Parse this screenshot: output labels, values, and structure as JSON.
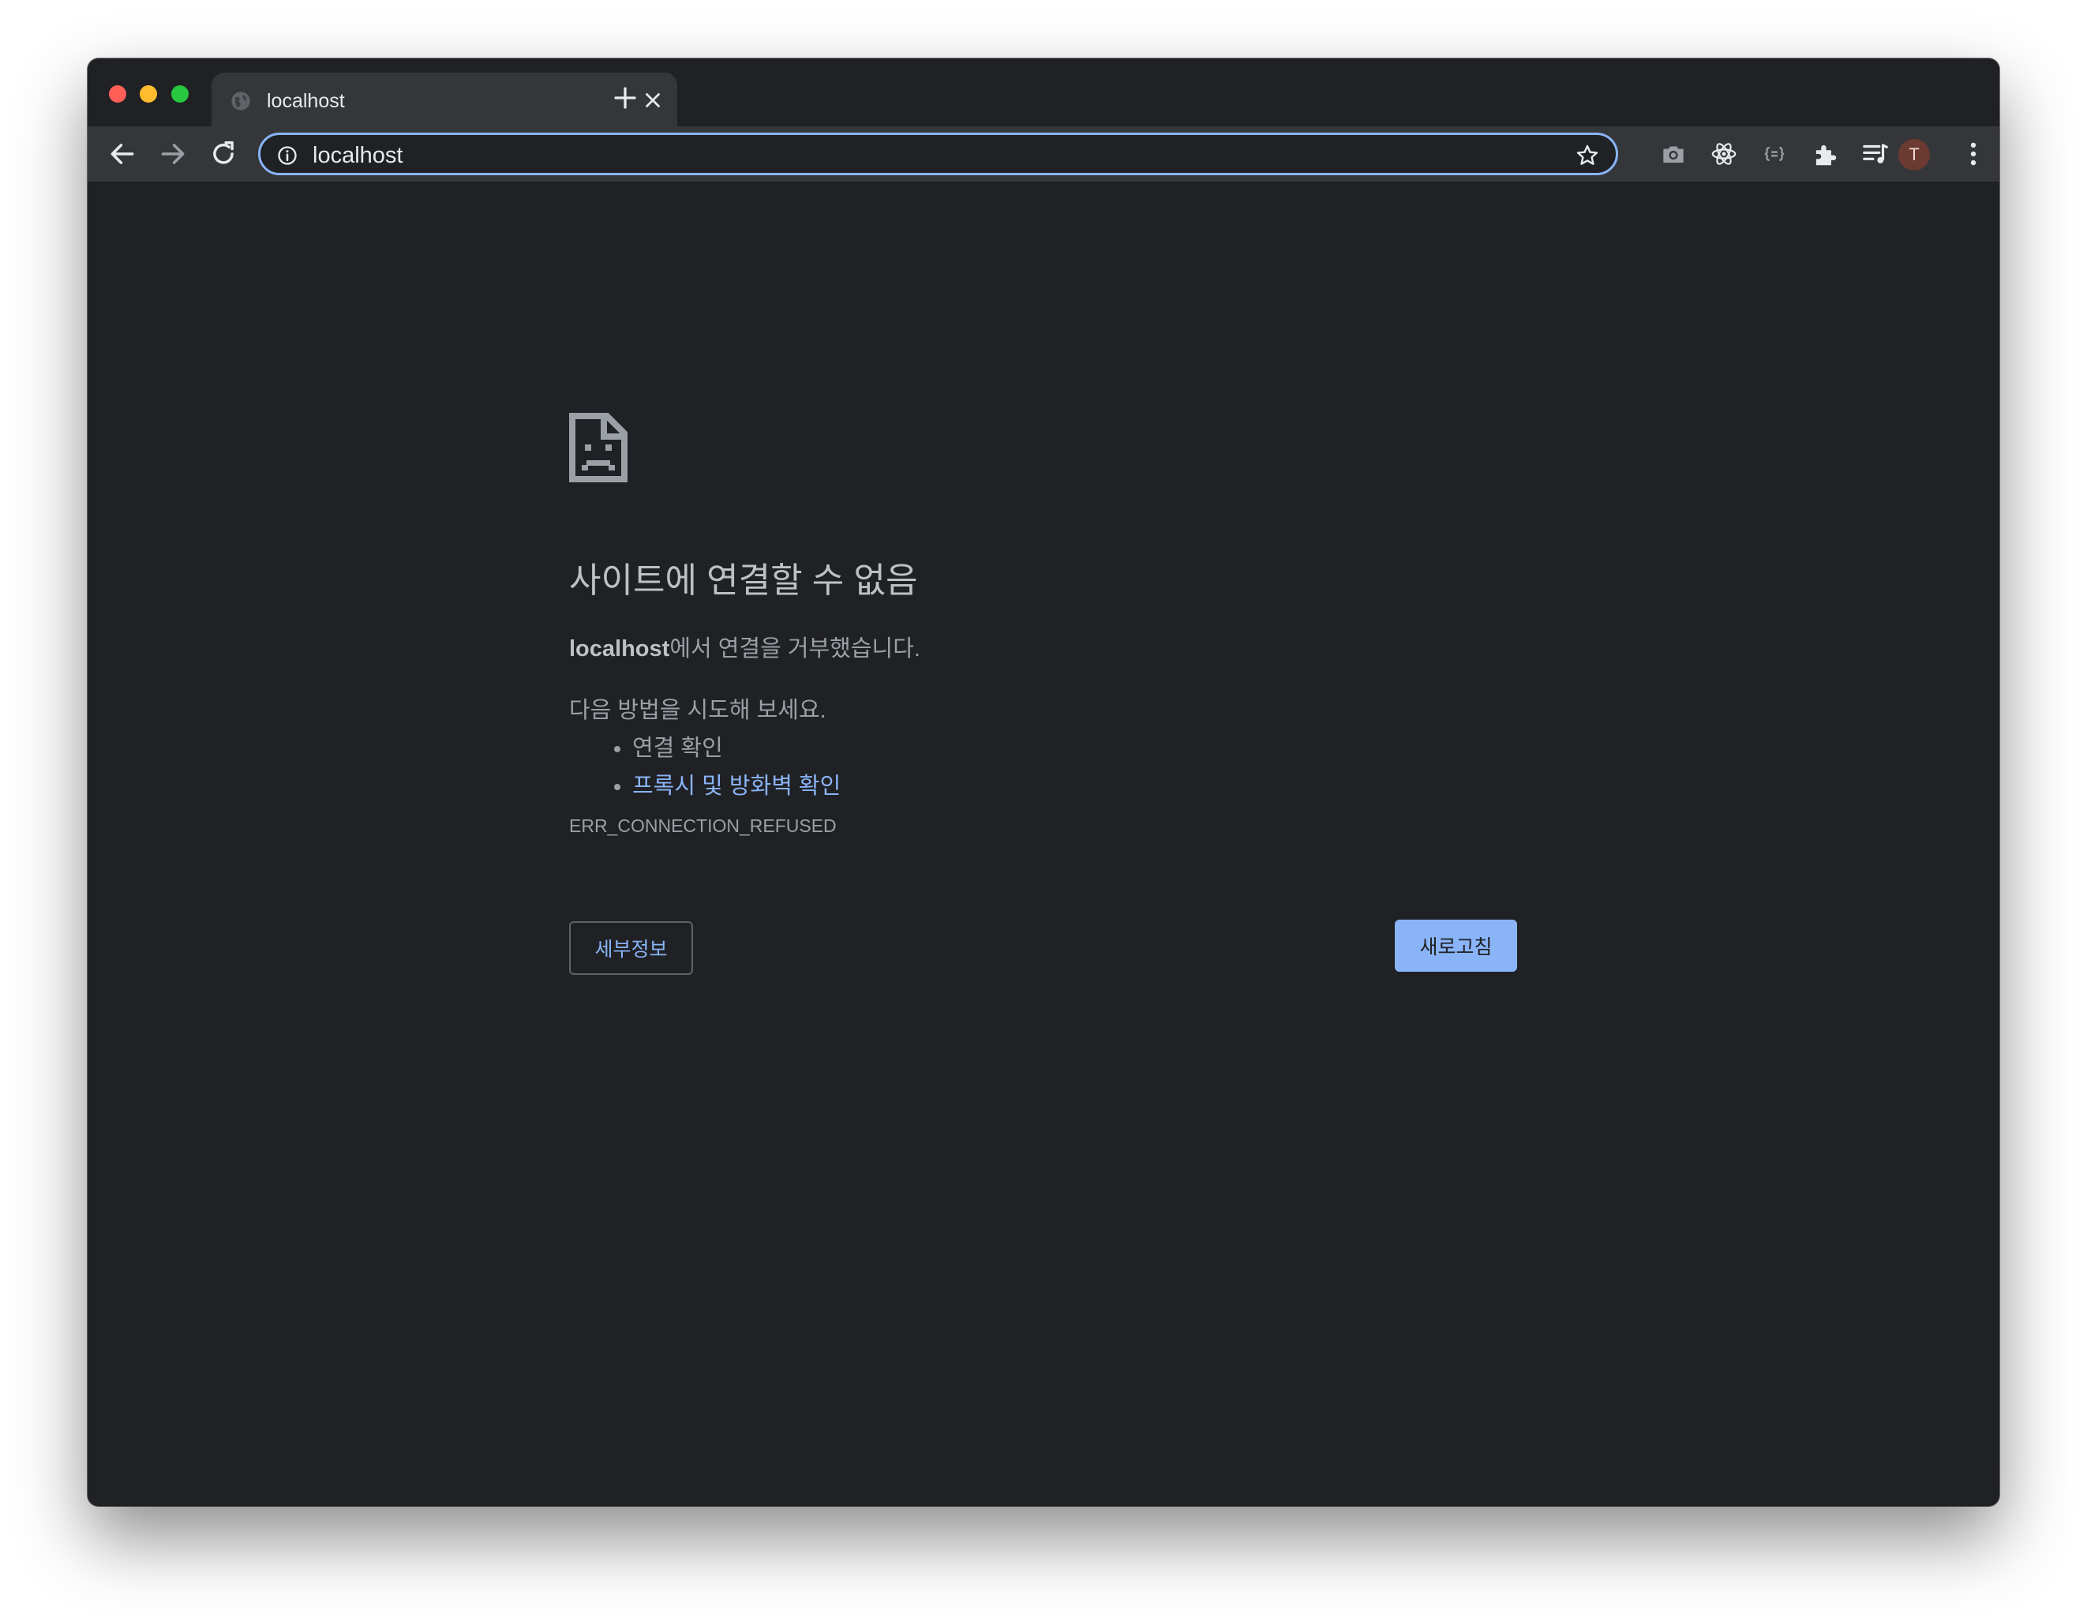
{
  "tab": {
    "title": "localhost"
  },
  "address_bar": {
    "url": "localhost"
  },
  "profile": {
    "initial": "T"
  },
  "error_page": {
    "heading": "사이트에 연결할 수 없음",
    "summary_host": "localhost",
    "summary_rest": "에서 연결을 거부했습니다.",
    "try_text": "다음 방법을 시도해 보세요.",
    "suggestions": [
      "연결 확인",
      "프록시 및 방화벽 확인"
    ],
    "error_code": "ERR_CONNECTION_REFUSED",
    "details_label": "세부정보",
    "reload_label": "새로고침"
  },
  "colors": {
    "background": "#202124",
    "toolbar": "#35363a",
    "link": "#8ab4f8",
    "primary_button": "#8ab4f8"
  },
  "icons": {
    "toolbar": [
      "back-icon",
      "forward-icon",
      "reload-icon",
      "info-icon",
      "star-icon",
      "camera-icon",
      "react-icon",
      "json-icon",
      "extensions-icon",
      "reading-list-icon",
      "menu-icon"
    ]
  }
}
